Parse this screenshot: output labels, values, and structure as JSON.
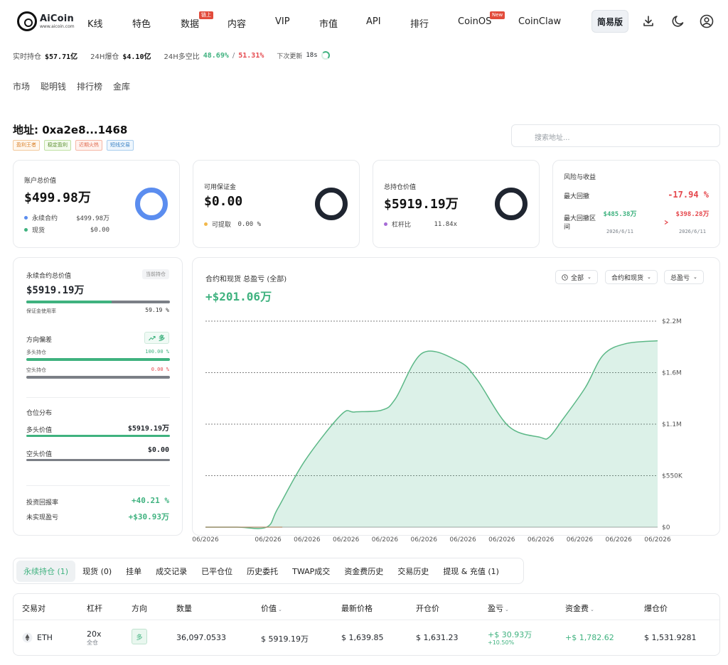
{
  "nav": {
    "logo": "AiCoin",
    "logo_sub": "www.aicoin.com",
    "items": [
      "K线",
      "特色",
      "数据",
      "内容",
      "VIP",
      "市值",
      "API",
      "排行",
      "CoinOS",
      "CoinClaw"
    ],
    "badge_data": "链上",
    "badge_coinos": "New",
    "simple_btn": "简易版"
  },
  "stats": {
    "open_interest_label": "实时持仓",
    "open_interest": "$57.71亿",
    "liq_label": "24H爆仓",
    "liq": "$4.10亿",
    "ls_label": "24H多空比",
    "long_pct": "48.69%",
    "sep": "/",
    "short_pct": "51.31%",
    "next_update_label": "下次更新",
    "next_update": "18s"
  },
  "subnav": [
    "市场",
    "聪明钱",
    "排行榜",
    "金库"
  ],
  "address": {
    "title": "地址: 0xa2e8...1468",
    "tags": [
      "盈利王者",
      "稳定盈利",
      "近期火热",
      "短线交易"
    ]
  },
  "search": {
    "placeholder": "搜索地址..."
  },
  "cards": {
    "account": {
      "label": "账户总价值",
      "value": "$499.98万",
      "row1_label": "永续合约",
      "row1_value": "$499.98万",
      "row2_label": "现货",
      "row2_value": "$0.00"
    },
    "margin": {
      "label": "可用保证金",
      "value": "$0.00",
      "row1_label": "可提取",
      "row1_value": "0.00 %"
    },
    "position": {
      "label": "总持仓价值",
      "value": "$5919.19万",
      "row1_label": "杠杆比",
      "row1_value": "11.84x"
    },
    "risk": {
      "label": "风险与收益",
      "drawdown_label": "最大回撤",
      "drawdown": "-17.94 %",
      "range_label": "最大回撤区间",
      "from_value": "$485.38万",
      "from_date": "2026/6/11",
      "to_value": "$398.28万",
      "to_date": "2026/6/11"
    }
  },
  "left_panel": {
    "title": "永续合约总价值",
    "badge": "当前持仓",
    "value": "$5919.19万",
    "margin_usage_label": "保证金使用率",
    "margin_usage": "59.19 %",
    "margin_usage_frac": 0.5919,
    "bias_title": "方向偏差",
    "bias_badge": "多",
    "long_label": "多头持仓",
    "long_pct": "100.00 %",
    "long_frac": 1.0,
    "short_label": "空头持仓",
    "short_pct": "0.00 %",
    "short_frac": 0.0,
    "dist_title": "仓位分布",
    "long_value_label": "多头价值",
    "long_value": "$5919.19万",
    "short_value_label": "空头价值",
    "short_value": "$0.00",
    "roi_label": "投资回报率",
    "roi": "+40.21 %",
    "upnl_label": "未实现盈亏",
    "upnl": "+$30.93万"
  },
  "chart_panel": {
    "title": "合约和现货 总盈亏 (全部)",
    "total": "+$201.06万",
    "dropdowns": [
      "全部",
      "合约和现货",
      "总盈亏"
    ]
  },
  "chart_data": {
    "type": "area",
    "x": [
      "06/2026",
      "06/2026",
      "06/2026",
      "06/2026",
      "06/2026",
      "06/2026",
      "06/2026",
      "06/2026",
      "06/2026",
      "06/2026",
      "06/2026",
      "06/2026"
    ],
    "y_ticks": [
      "$2.2M",
      "$1.6M",
      "$1.1M",
      "$550K",
      "$0"
    ],
    "ylim": [
      0,
      2200000
    ],
    "series": [
      {
        "color": "#5cb887",
        "points": [
          [
            0,
            0
          ],
          [
            0.07,
            0
          ],
          [
            0.135,
            0
          ],
          [
            0.16,
            200000
          ],
          [
            0.22,
            710000
          ],
          [
            0.3,
            1200000
          ],
          [
            0.33,
            1230000
          ],
          [
            0.39,
            1250000
          ],
          [
            0.42,
            1370000
          ],
          [
            0.48,
            1860000
          ],
          [
            0.56,
            1770000
          ],
          [
            0.6,
            1580000
          ],
          [
            0.67,
            1080000
          ],
          [
            0.74,
            960000
          ],
          [
            0.76,
            960000
          ],
          [
            0.79,
            1150000
          ],
          [
            0.84,
            1490000
          ],
          [
            0.88,
            1840000
          ],
          [
            0.93,
            1960000
          ],
          [
            1.0,
            1990000
          ]
        ]
      }
    ]
  },
  "tabs": [
    "永续持仓 (1)",
    "现货 (0)",
    "挂单",
    "成交记录",
    "已平仓位",
    "历史委托",
    "TWAP成交",
    "资金费历史",
    "交易历史",
    "提现 & 充值 (1)"
  ],
  "table": {
    "headers": [
      "交易对",
      "杠杆",
      "方向",
      "数量",
      "价值",
      "最新价格",
      "开仓价",
      "盈亏",
      "资金费",
      "爆仓价"
    ],
    "row": {
      "pair": "ETH",
      "leverage": "20x",
      "leverage_mode": "全仓",
      "side": "多",
      "qty": "36,097.0533",
      "value": "$ 5919.19万",
      "last_price": "$ 1,639.85",
      "entry_price": "$ 1,631.23",
      "pnl": "+$ 30.93万",
      "pnl_pct": "+10.50%",
      "funding": "+$ 1,782.62",
      "liq_price": "$ 1,531.9281"
    }
  },
  "colors": {
    "green": "#3fb27f",
    "red": "#e5484d",
    "ring_blue": "#5b8def",
    "ring_dark": "#1f2530"
  }
}
